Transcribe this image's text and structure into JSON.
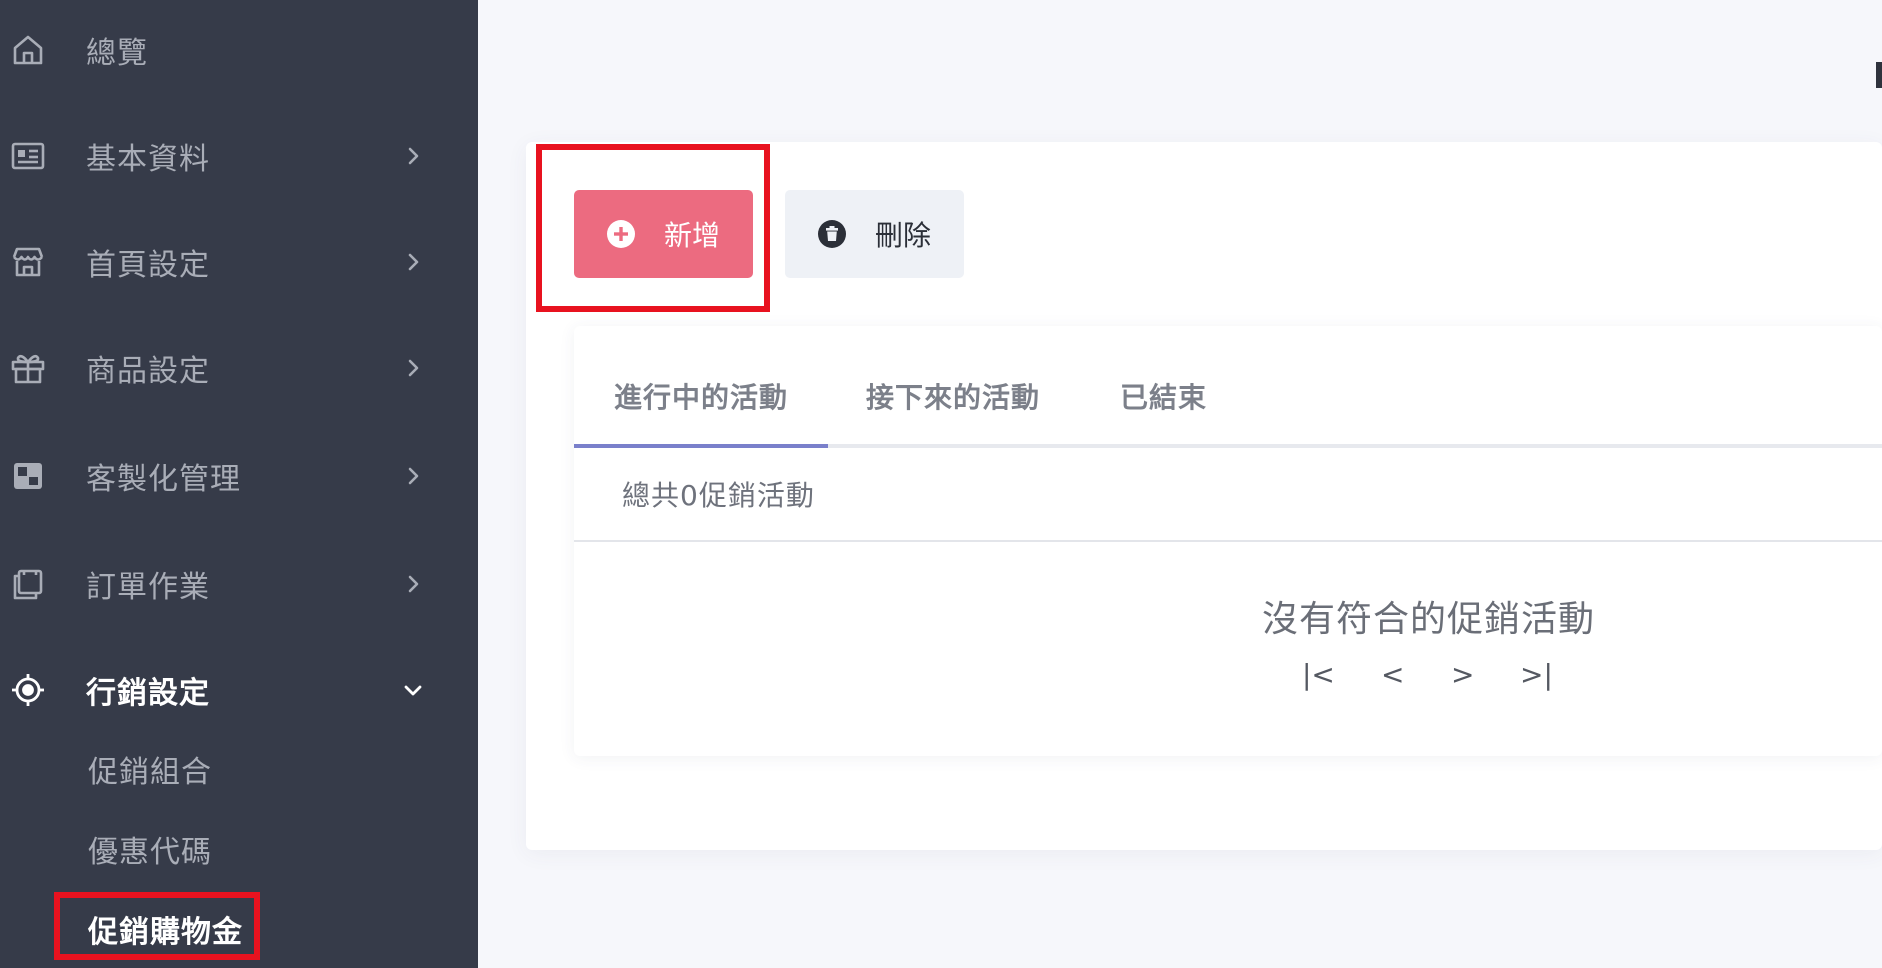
{
  "sidebar": {
    "items": [
      {
        "label": "總覽",
        "icon": "home-icon"
      },
      {
        "label": "基本資料",
        "icon": "id-card-icon"
      },
      {
        "label": "首頁設定",
        "icon": "store-icon"
      },
      {
        "label": "商品設定",
        "icon": "gift-icon"
      },
      {
        "label": "客製化管理",
        "icon": "custom-icon"
      },
      {
        "label": "訂單作業",
        "icon": "clipboard-icon"
      },
      {
        "label": "行銷設定",
        "icon": "target-icon"
      }
    ],
    "submenu": [
      {
        "label": "促銷組合"
      },
      {
        "label": "優惠代碼"
      },
      {
        "label": "促銷購物金"
      }
    ]
  },
  "toolbar": {
    "add_label": "新增",
    "delete_label": "刪除"
  },
  "tabs": [
    {
      "label": "進行中的活動"
    },
    {
      "label": "接下來的活動"
    },
    {
      "label": "已結束"
    }
  ],
  "summary": {
    "total_text": "總共0促銷活動"
  },
  "empty_state": {
    "message": "沒有符合的促銷活動"
  },
  "pagination": {
    "first": "|<",
    "prev": "<",
    "next": ">",
    "last": ">|"
  },
  "colors": {
    "sidebar_bg": "#363b49",
    "accent_pink": "#ec6b80",
    "tab_indicator": "#7a80cb",
    "highlight_red": "#e8121f"
  }
}
